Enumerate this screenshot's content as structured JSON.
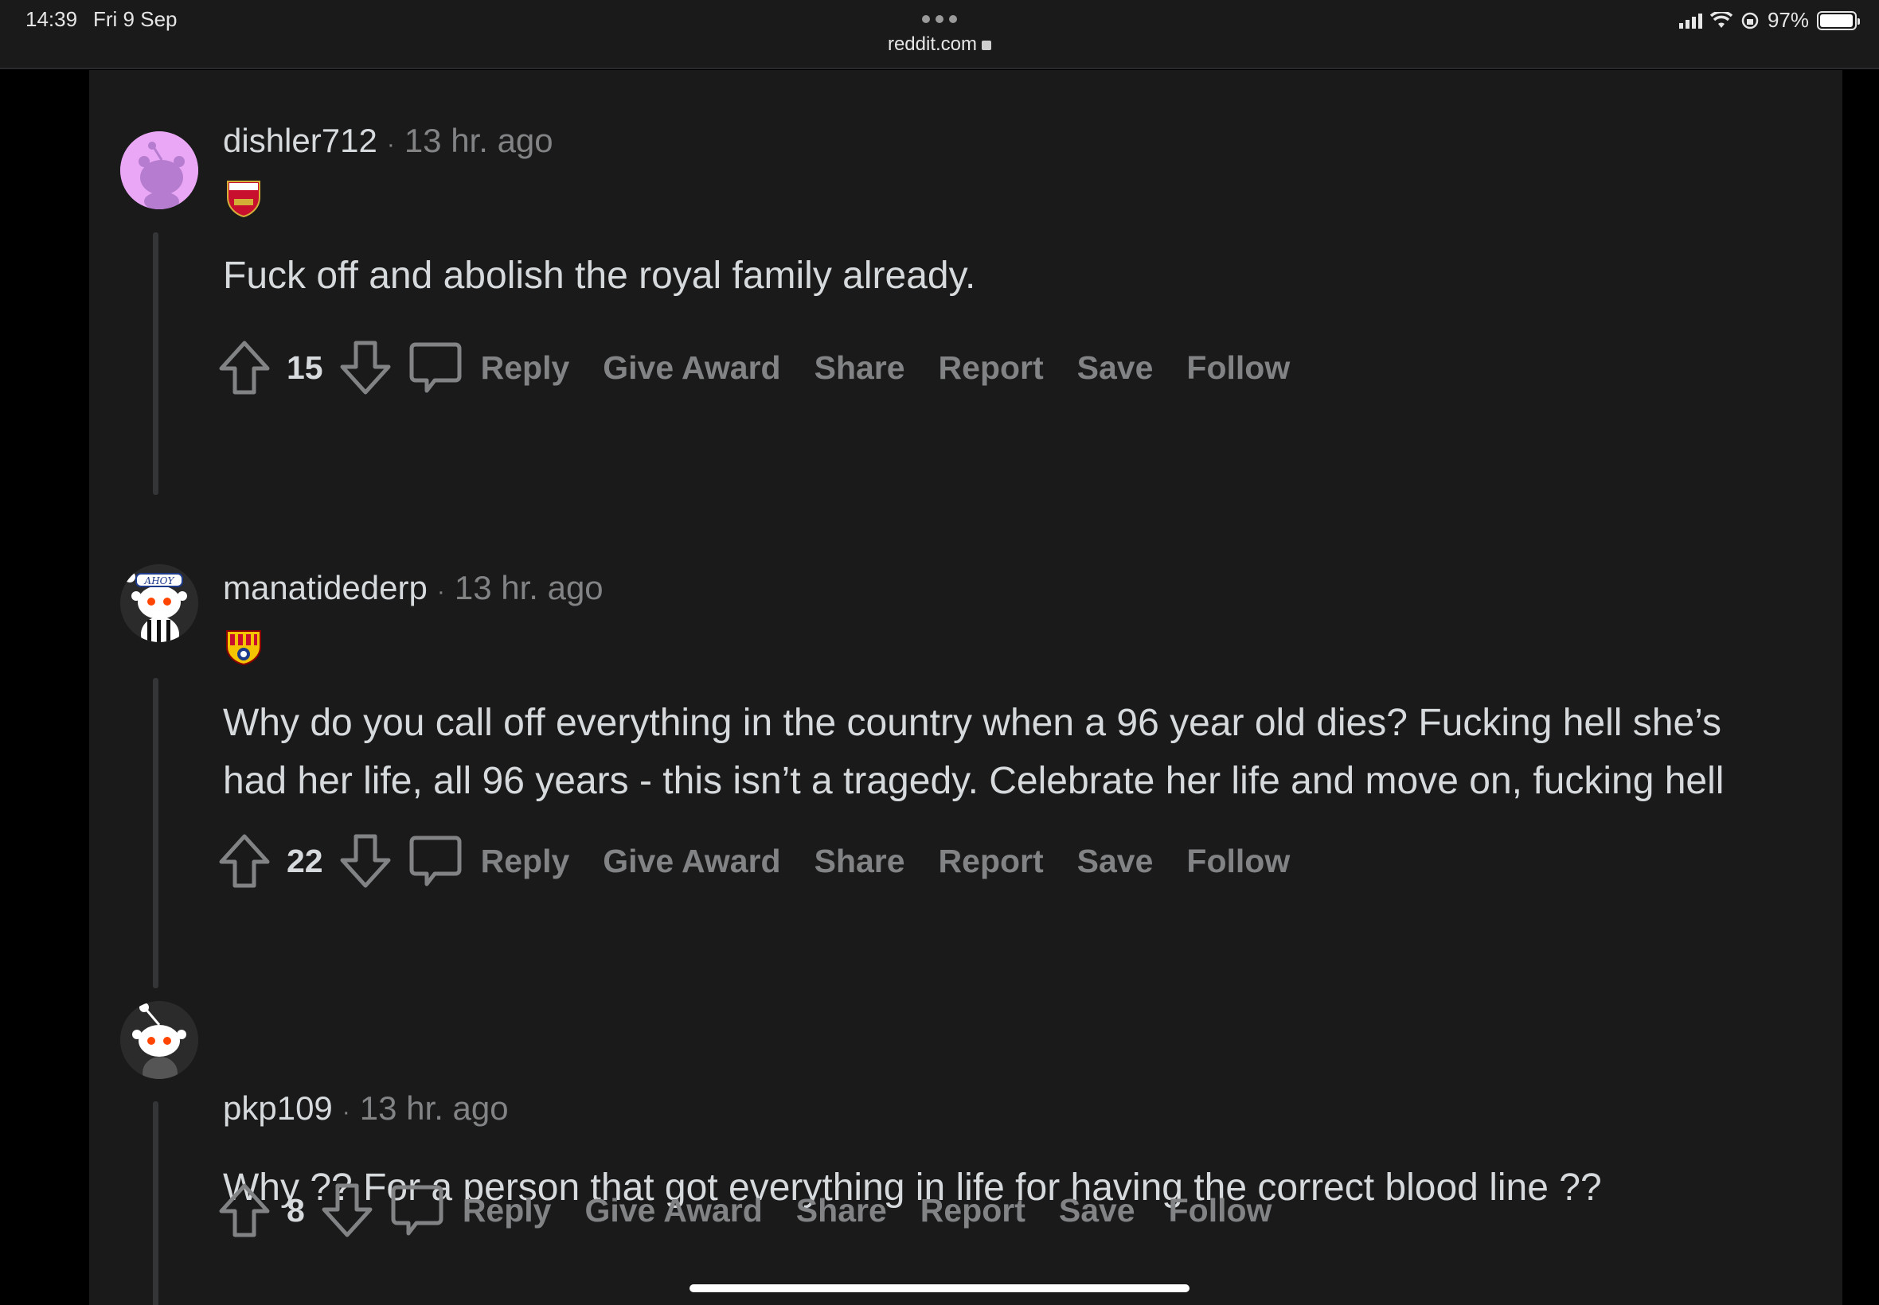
{
  "status_bar": {
    "time": "14:39",
    "date": "Fri 9 Sep",
    "url": "reddit.com",
    "battery": "97%",
    "battery_level": 0.97
  },
  "colors": {
    "background": "#1a1a1b",
    "text": "#d7dadc",
    "muted": "#818384",
    "thread_line": "#343536"
  },
  "comments": [
    {
      "author": "dishler712",
      "separator": "·",
      "time": "13 hr. ago",
      "flair_icon": "arsenal-badge-icon",
      "avatar_icon": "snoo-avatar-icon",
      "body": "Fuck off and abolish the royal family already.",
      "votes": "15",
      "actions": [
        "Reply",
        "Give Award",
        "Share",
        "Report",
        "Save",
        "Follow"
      ]
    },
    {
      "author": "manatidederp",
      "separator": "·",
      "time": "13 hr. ago",
      "flair_icon": "barcelona-sc-badge-icon",
      "avatar_icon": "snoo-sailor-avatar-icon",
      "avatar_hat_text": "AHOY",
      "body": "Why do you call off everything in the country when a 96 year old dies? Fucking hell she’s had her life, all 96 years - this isn’t a tragedy. Celebrate her life and move on, fucking hell",
      "votes": "22",
      "actions": [
        "Reply",
        "Give Award",
        "Share",
        "Report",
        "Save",
        "Follow"
      ]
    },
    {
      "author": "pkp109",
      "separator": "·",
      "time": "13 hr. ago",
      "avatar_icon": "snoo-avatar-icon",
      "body": "Why ?? For a person that got everything in life for having the correct blood line ??",
      "votes": "8",
      "actions": [
        "Reply",
        "Give Award",
        "Share",
        "Report",
        "Save",
        "Follow"
      ]
    }
  ]
}
